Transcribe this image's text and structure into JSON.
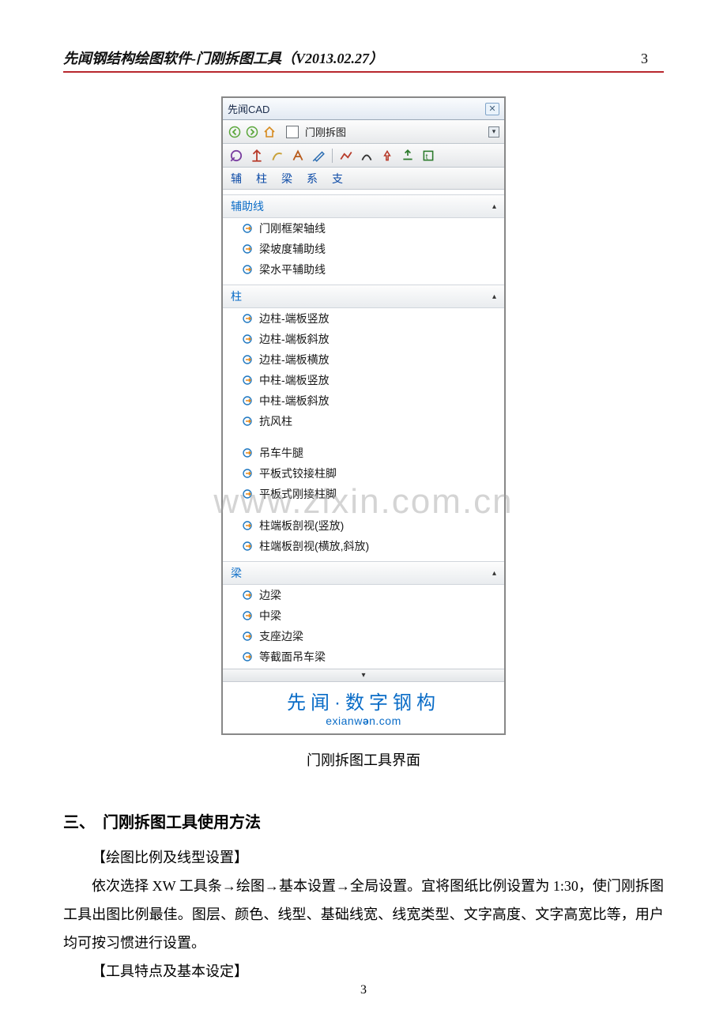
{
  "header": {
    "title": "先闻钢结构绘图软件-门刚拆图工具（V2013.02.27）",
    "page_number_top": "3"
  },
  "watermark": "www.zixin.com.cn",
  "cad": {
    "window_title": "先闻CAD",
    "close_icon": "✕",
    "nav_label": "门刚拆图",
    "dropdown_glyph": "▾",
    "tabs": [
      "辅",
      "柱",
      "梁",
      "系",
      "支"
    ],
    "groups": [
      {
        "title": "辅助线",
        "items": [
          "门刚框架轴线",
          "梁坡度辅助线",
          "梁水平辅助线"
        ]
      },
      {
        "title": "柱",
        "blocks": [
          [
            "边柱-端板竖放",
            "边柱-端板斜放",
            "边柱-端板横放",
            "中柱-端板竖放",
            "中柱-端板斜放",
            "抗风柱"
          ],
          [
            "吊车牛腿",
            "平板式铰接柱脚",
            "平板式刚接柱脚"
          ],
          [
            "柱端板剖视(竖放)",
            "柱端板剖视(横放,斜放)"
          ]
        ]
      },
      {
        "title": "梁",
        "items": [
          "边梁",
          "中梁",
          "支座边梁",
          "等截面吊车梁"
        ]
      }
    ],
    "scroll_glyph": "▾",
    "logo_main": "先闻·数字钢构",
    "logo_sub_pre": "exianw",
    "logo_sub_mid": "ə",
    "logo_sub_post": "n.com"
  },
  "caption": "门刚拆图工具界面",
  "section": {
    "heading": "三、　门刚拆图工具使用方法",
    "p1": "【绘图比例及线型设置】",
    "p2": "依次选择 XW 工具条→绘图→基本设置→全局设置。宜将图纸比例设置为 1:30，使门刚拆图工具出图比例最佳。图层、颜色、线型、基础线宽、线宽类型、文字高度、文字高宽比等，用户均可按习惯进行设置。",
    "p3": "【工具特点及基本设定】"
  },
  "footer": {
    "page_number_bottom": "3"
  }
}
